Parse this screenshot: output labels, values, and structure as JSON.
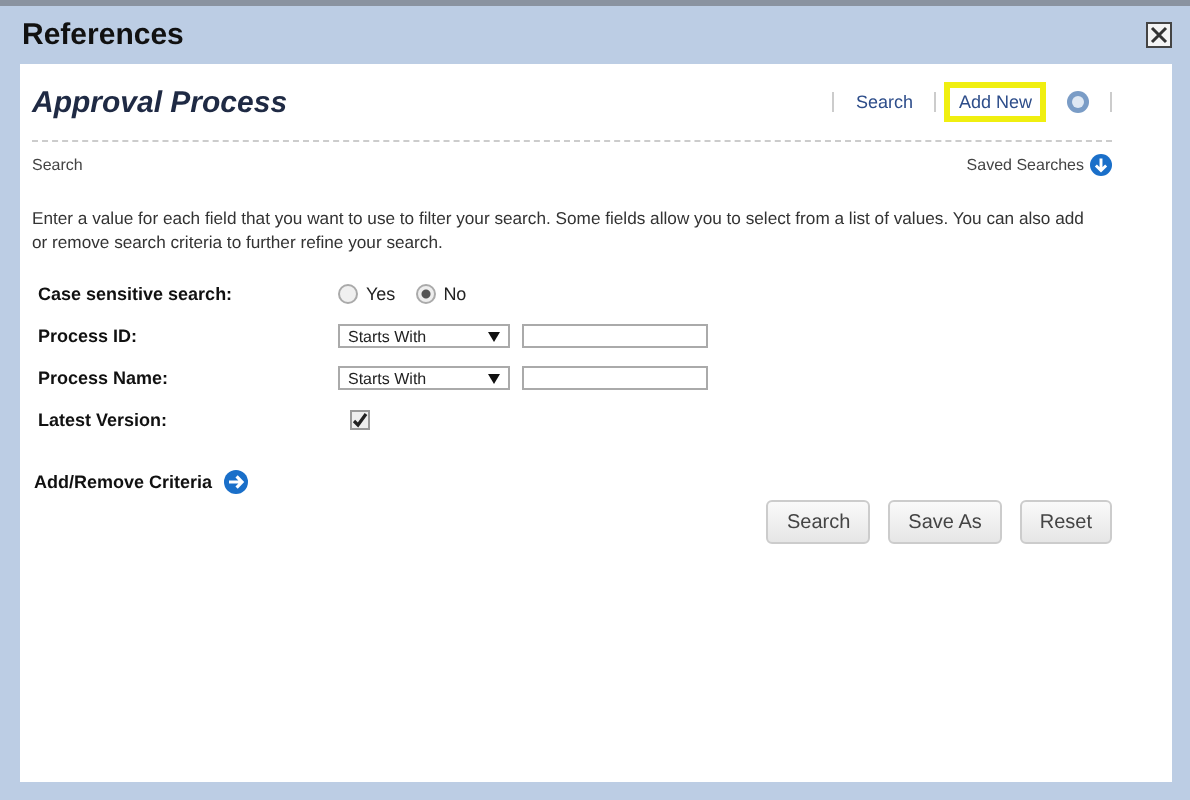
{
  "window": {
    "title": "References"
  },
  "header": {
    "title": "Approval Process",
    "links": [
      {
        "label": "Search",
        "highlighted": false
      },
      {
        "label": "Add New",
        "highlighted": true
      }
    ]
  },
  "section": {
    "label": "Search",
    "saved_searches": "Saved Searches"
  },
  "description": "Enter a value for each field that you want to use to filter your search. Some fields allow you to select from a list of values. You can also add or remove search criteria to further refine your search.",
  "fields": [
    {
      "kind": "radio",
      "label": "Case sensitive search:",
      "options": [
        {
          "label": "Yes",
          "selected": false
        },
        {
          "label": "No",
          "selected": true
        }
      ]
    },
    {
      "kind": "text",
      "label": "Process ID:",
      "operator": "Starts With"
    },
    {
      "kind": "text",
      "label": "Process Name:",
      "operator": "Starts With"
    },
    {
      "kind": "checkbox",
      "label": "Latest Version:",
      "checked": true
    }
  ],
  "add_remove": "Add/Remove Criteria",
  "buttons": [
    "Search",
    "Save As",
    "Reset"
  ]
}
